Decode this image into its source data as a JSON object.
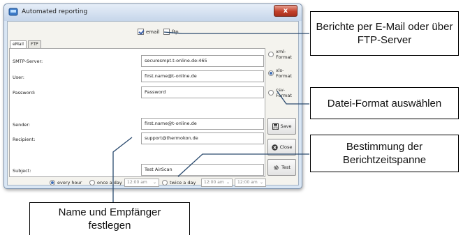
{
  "window": {
    "title": "Automated reporting",
    "close_glyph": "x",
    "app_icon": "report-app-icon"
  },
  "delivery": {
    "email_label": "email",
    "email_checked": true,
    "ftp_label": "ftp",
    "ftp_checked": false
  },
  "tabs": [
    {
      "label": "eMail",
      "active": true
    },
    {
      "label": "FTP",
      "active": false
    }
  ],
  "form": {
    "smtp_label": "SMTP-Server:",
    "smtp_value": "securesmpt.t-online.de:465",
    "user_label": "User:",
    "user_value": "first.name@t-online.de",
    "password_label": "Password:",
    "password_value": "Password",
    "sender_label": "Sender:",
    "sender_value": "first.name@t-online.de",
    "recipient_label": "Recipient:",
    "recipient_value": "support@thermokon.de",
    "subject_label": "Subject:",
    "subject_value": "Test AirScan"
  },
  "format": {
    "options": [
      {
        "label": "xml-Format",
        "selected": false
      },
      {
        "label": "xls-Format",
        "selected": true
      },
      {
        "label": "csv-Format",
        "selected": false
      }
    ]
  },
  "buttons": {
    "save_label": "Save",
    "close_label": "Close",
    "test_label": "Test"
  },
  "schedule": {
    "every_hour_label": "every hour",
    "once_a_day_label": "once a day",
    "twice_a_day_label": "twice a day",
    "selected": "every hour",
    "time_once": "12:00 am",
    "time_twice_1": "12:00 am",
    "time_twice_2": "12:00 am"
  },
  "callouts": {
    "delivery": "Berichte per E-Mail oder über FTP-Server",
    "format": "Datei-Format auswählen",
    "period": "Bestimmung der Berichtzeitspanne",
    "recipient": "Name und Empfänger festlegen"
  },
  "colors": {
    "window_frame": "#d9e6f4",
    "close_button": "#c3412b",
    "radio_accent": "#3f6db3",
    "callout_line": "#2a4a6e"
  }
}
